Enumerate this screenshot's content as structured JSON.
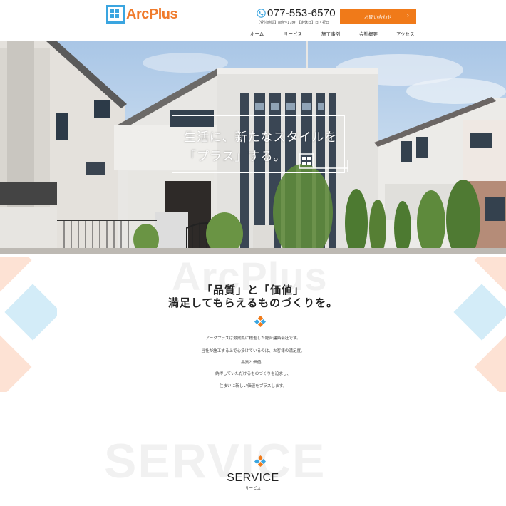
{
  "header": {
    "logo_text": "ArcPlus",
    "phone": "077-553-6570",
    "hours": "【受付時間】8時〜17時　【定休日】日・祝日",
    "contact_button": "お問い合わせ",
    "nav": [
      "ホーム",
      "サービス",
      "施工事例",
      "会社概要",
      "アクセス"
    ]
  },
  "hero": {
    "line1": "生活に、新たなスタイルを",
    "line2": "「プラス」する。"
  },
  "intro": {
    "watermark": "ArcPlus",
    "heading_line1": "「品質」と「価値」",
    "heading_line2": "満足してもらえるものづくりを。",
    "paragraphs": [
      "アークプラスは滋賀県に根差した総合建築会社です。",
      "当社が施工する上で心掛けているのは、お客様の満足度。",
      "品質と価値。",
      "納得していただけるものづくりを追求し、",
      "住まいに新しい価値をプラスします。"
    ]
  },
  "service": {
    "watermark": "SERVICE",
    "title": "SERVICE",
    "subtitle": "サービス"
  },
  "colors": {
    "accent_orange": "#f07a19",
    "logo_blue": "#3aa5e0",
    "deco_peach": "#fde2d4",
    "deco_blue": "#d3ecf8"
  }
}
